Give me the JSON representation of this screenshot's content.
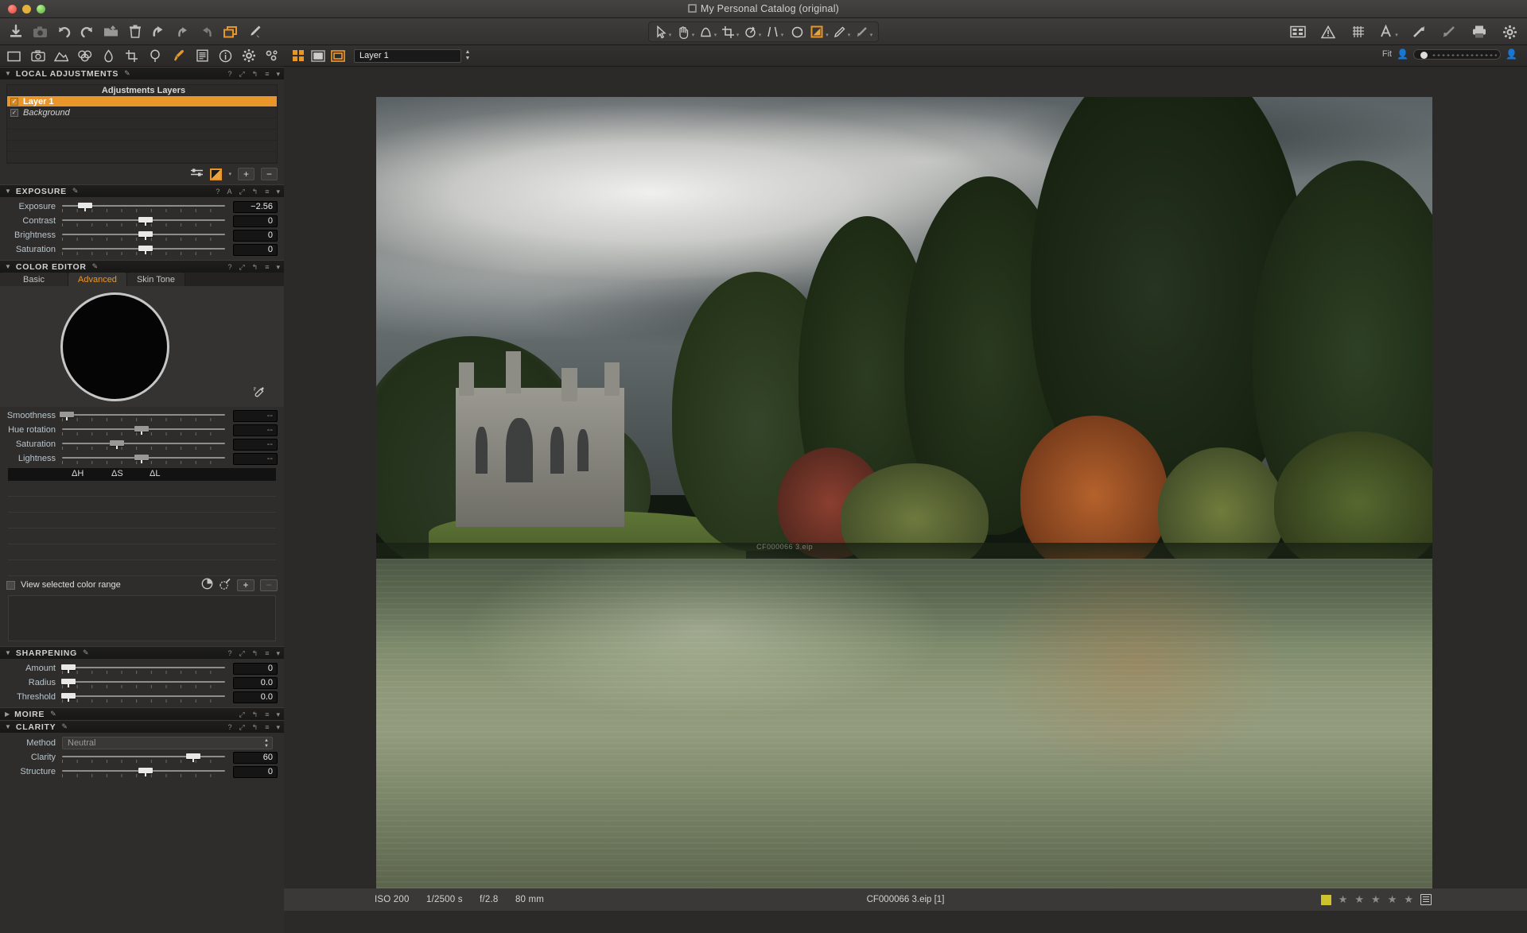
{
  "window": {
    "title": "My Personal Catalog (original)",
    "traffic_lights": [
      "close",
      "minimize",
      "zoom"
    ]
  },
  "main_toolbar": {
    "left_tools": [
      {
        "name": "import-images-icon",
        "glyph": "import"
      },
      {
        "name": "capture-icon",
        "glyph": "camera"
      },
      {
        "name": "rotate-left-icon",
        "glyph": "rot-ccw"
      },
      {
        "name": "rotate-right-icon",
        "glyph": "rot-cw"
      },
      {
        "name": "export-originals-icon",
        "glyph": "folder-out"
      },
      {
        "name": "delete-icon",
        "glyph": "trash"
      },
      {
        "name": "undo-icon",
        "glyph": "undo"
      },
      {
        "name": "reset-icon",
        "glyph": "arrow-back"
      },
      {
        "name": "redo-icon",
        "glyph": "arrow-fwd"
      },
      {
        "name": "copy-apply-adjustments-icon",
        "glyph": "layers",
        "active": true
      },
      {
        "name": "styles-brush-icon",
        "glyph": "brush"
      }
    ],
    "center_tools": [
      {
        "name": "pointer-tool",
        "glyph": "cursor",
        "dropdown": true
      },
      {
        "name": "pan-tool",
        "glyph": "hand",
        "dropdown": true
      },
      {
        "name": "spot-removal-tool",
        "glyph": "dust",
        "dropdown": true
      },
      {
        "name": "crop-tool",
        "glyph": "crop",
        "dropdown": true
      },
      {
        "name": "rotate-tool",
        "glyph": "rotate",
        "dropdown": true
      },
      {
        "name": "keystone-tool",
        "glyph": "keystone",
        "dropdown": true
      },
      {
        "name": "white-balance-picker",
        "glyph": "circle",
        "dropdown": false
      },
      {
        "name": "draw-mask-tool",
        "glyph": "mask",
        "active": true,
        "dropdown": true
      },
      {
        "name": "gradient-mask-tool",
        "glyph": "pen",
        "dropdown": true
      },
      {
        "name": "erase-mask-tool",
        "glyph": "arrow-dl",
        "dropdown": true
      }
    ],
    "right_tools": [
      {
        "name": "viewer-grid-icon",
        "glyph": "grid-view"
      },
      {
        "name": "exposure-warning-icon",
        "glyph": "warning"
      },
      {
        "name": "grid-overlay-icon",
        "glyph": "grid-lines"
      },
      {
        "name": "font-size-icon",
        "glyph": "A",
        "dropdown": true
      },
      {
        "name": "zoom-in-icon",
        "glyph": "arrow-up-right"
      },
      {
        "name": "zoom-out-icon",
        "glyph": "arrow-down-left"
      },
      {
        "name": "print-icon",
        "glyph": "printer"
      },
      {
        "name": "preferences-icon",
        "glyph": "gear"
      }
    ]
  },
  "tool_tabs": [
    {
      "name": "library-tab",
      "glyph": "folder",
      "active": false
    },
    {
      "name": "capture-tab",
      "glyph": "camera",
      "active": false
    },
    {
      "name": "lens-tab",
      "glyph": "lens",
      "active": false
    },
    {
      "name": "color-tab",
      "glyph": "color-circles",
      "active": false
    },
    {
      "name": "exposure-tab",
      "glyph": "exposure-drop",
      "active": false
    },
    {
      "name": "composition-tab",
      "glyph": "crop",
      "active": false
    },
    {
      "name": "details-tab",
      "glyph": "magnifier",
      "active": false
    },
    {
      "name": "local-adjustments-tab",
      "glyph": "brush",
      "active": true
    },
    {
      "name": "metadata-tab",
      "glyph": "list",
      "active": false
    },
    {
      "name": "output-tab",
      "glyph": "info",
      "active": false
    },
    {
      "name": "adjustments-tab",
      "glyph": "gear",
      "active": false
    },
    {
      "name": "custom-tab",
      "glyph": "gears-small",
      "active": false
    }
  ],
  "layer_bar": {
    "view_modes": [
      {
        "name": "browser-grid-view",
        "glyph": "grid",
        "active": true
      },
      {
        "name": "single-viewer-view",
        "glyph": "single",
        "active": false
      },
      {
        "name": "viewer-browser-view",
        "glyph": "frame",
        "active": true
      }
    ],
    "layer_value": "Layer 1",
    "zoom_label": "Fit"
  },
  "panels": {
    "local_adjustments": {
      "title": "LOCAL ADJUSTMENTS",
      "header_column": "Adjustments Layers",
      "layers": [
        {
          "name": "Layer 1",
          "checked": true,
          "selected": true,
          "italic": false
        },
        {
          "name": "Background",
          "checked": true,
          "selected": false,
          "italic": true
        }
      ],
      "blank_rows": 4,
      "buttons": [
        {
          "name": "layer-options-icon",
          "glyph": "sliders"
        },
        {
          "name": "mask-mode-swatch",
          "glyph": "mask"
        },
        {
          "name": "add-layer-button",
          "label": "+"
        },
        {
          "name": "remove-layer-button",
          "label": "−"
        }
      ]
    },
    "exposure": {
      "title": "EXPOSURE",
      "sliders": [
        {
          "label": "Exposure",
          "value": "−2.56",
          "pos": 14
        },
        {
          "label": "Contrast",
          "value": "0",
          "pos": 50
        },
        {
          "label": "Brightness",
          "value": "0",
          "pos": 50
        },
        {
          "label": "Saturation",
          "value": "0",
          "pos": 50
        }
      ]
    },
    "color_editor": {
      "title": "COLOR EDITOR",
      "tabs": [
        {
          "label": "Basic",
          "active": false
        },
        {
          "label": "Advanced",
          "active": true
        },
        {
          "label": "Skin Tone",
          "active": false
        }
      ],
      "sliders": [
        {
          "label": "Smoothness",
          "value": "--",
          "pos": 2
        },
        {
          "label": "Hue rotation",
          "value": "--",
          "pos": 48
        },
        {
          "label": "Saturation",
          "value": "--",
          "pos": 33
        },
        {
          "label": "Lightness",
          "value": "--",
          "pos": 48
        }
      ],
      "delta_labels": [
        "ΔH",
        "ΔS",
        "ΔL"
      ],
      "view_selected_color_range": "View selected color range",
      "range_buttons": [
        {
          "name": "pie-view-icon",
          "glyph": "pie"
        },
        {
          "name": "color-picker-icon",
          "glyph": "picker"
        },
        {
          "name": "add-color-range-button",
          "label": "+"
        },
        {
          "name": "remove-color-range-button",
          "label": "−"
        }
      ]
    },
    "sharpening": {
      "title": "SHARPENING",
      "sliders": [
        {
          "label": "Amount",
          "value": "0",
          "pos": 3
        },
        {
          "label": "Radius",
          "value": "0.0",
          "pos": 3
        },
        {
          "label": "Threshold",
          "value": "0.0",
          "pos": 3
        }
      ]
    },
    "moire": {
      "title": "MOIRE",
      "collapsed": true
    },
    "clarity": {
      "title": "CLARITY",
      "method_label": "Method",
      "method_value": "Neutral",
      "sliders": [
        {
          "label": "Clarity",
          "value": "60",
          "pos": 79
        },
        {
          "label": "Structure",
          "value": "0",
          "pos": 50
        }
      ]
    }
  },
  "viewer": {
    "status": {
      "iso": "ISO 200",
      "shutter": "1/2500 s",
      "aperture": "f/2.8",
      "focal": "80 mm",
      "filename": "CF000066 3.eip [1]",
      "color_tag": "#cfc32c",
      "stars": 5
    },
    "image_caption": "CF000066 3.eip"
  }
}
